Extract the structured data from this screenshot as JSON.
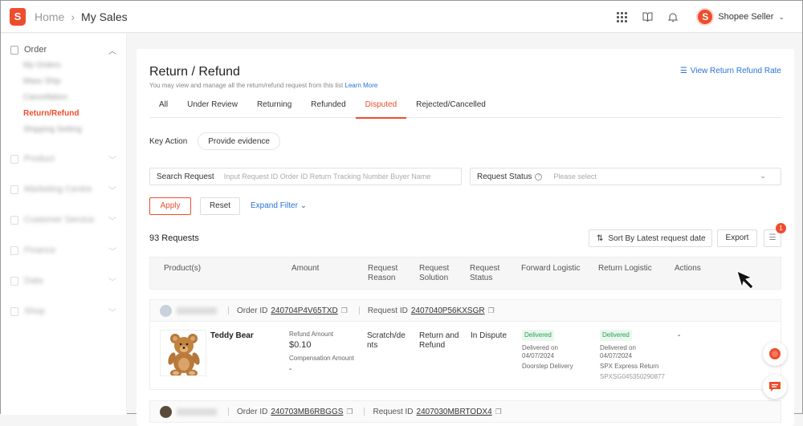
{
  "colors": {
    "accent": "#ee4d2d",
    "link": "#2673dd",
    "success": "#2e9b52"
  },
  "topbar": {
    "home": "Home",
    "current": "My Sales",
    "shop_name": "Shopee Seller",
    "icons": [
      "apps-grid-icon",
      "book-icon",
      "bell-icon"
    ]
  },
  "sidebar": {
    "order": {
      "label": "Order",
      "items": [
        "My Orders",
        "Mass Ship",
        "Cancellation",
        "Return/Refund",
        "Shipping Setting"
      ],
      "active_index": 3
    },
    "other_groups": [
      "Product",
      "Marketing Centre",
      "Customer Service",
      "Finance",
      "Data",
      "Shop"
    ]
  },
  "page": {
    "title": "Return / Refund",
    "subtitle": "You may view and manage all the return/refund request from this list",
    "learn_more": "Learn More",
    "rate_link": "View Return Refund Rate",
    "tabs": [
      "All",
      "Under Review",
      "Returning",
      "Refunded",
      "Disputed",
      "Rejected/Cancelled"
    ],
    "active_tab": 4
  },
  "filters": {
    "key_action_label": "Key Action",
    "key_action_pill": "Provide evidence",
    "search_label": "Search Request",
    "search_placeholder": "Input Request ID Order ID Return Tracking Number Buyer Name",
    "status_label": "Request Status",
    "status_placeholder": "Please select",
    "apply": "Apply",
    "reset": "Reset",
    "expand": "Expand Filter"
  },
  "list": {
    "count_label": "93 Requests",
    "sort_label": "Sort By Latest request date",
    "export_label": "Export",
    "menu_badge": "1",
    "columns": {
      "product": "Product(s)",
      "amount": "Amount",
      "reason_1": "Request",
      "reason_2": "Reason",
      "solution_1": "Request",
      "solution_2": "Solution",
      "status_1": "Request",
      "status_2": "Status",
      "forward": "Forward Logistic",
      "return": "Return Logistic",
      "actions": "Actions"
    },
    "orders": [
      {
        "order_id_label": "Order ID",
        "order_id": "240704P4V65TXD",
        "request_id_label": "Request ID",
        "request_id": "2407040P56KXSGR",
        "product_name": "Teddy Bear",
        "refund_amount_label": "Refund Amount",
        "refund_amount": "$0.10",
        "compensation_label": "Compensation Amount",
        "compensation": "-",
        "reason_1": "Scratch/de",
        "reason_2": "nts",
        "solution_1": "Return and",
        "solution_2": "Refund",
        "status": "In Dispute",
        "forward_tag": "Delivered",
        "forward_date_1": "Delivered on",
        "forward_date_2": "04/07/2024",
        "forward_method": "Doorstep Delivery",
        "return_tag": "Delivered",
        "return_date_1": "Delivered on",
        "return_date_2": "04/07/2024",
        "return_method": "SPX Express Return",
        "return_tracking": "SPXSG045350290877",
        "action": "-"
      },
      {
        "order_id_label": "Order ID",
        "order_id": "240703MB6RBGGS",
        "request_id_label": "Request ID",
        "request_id": "2407030MBRTODX4"
      }
    ]
  }
}
